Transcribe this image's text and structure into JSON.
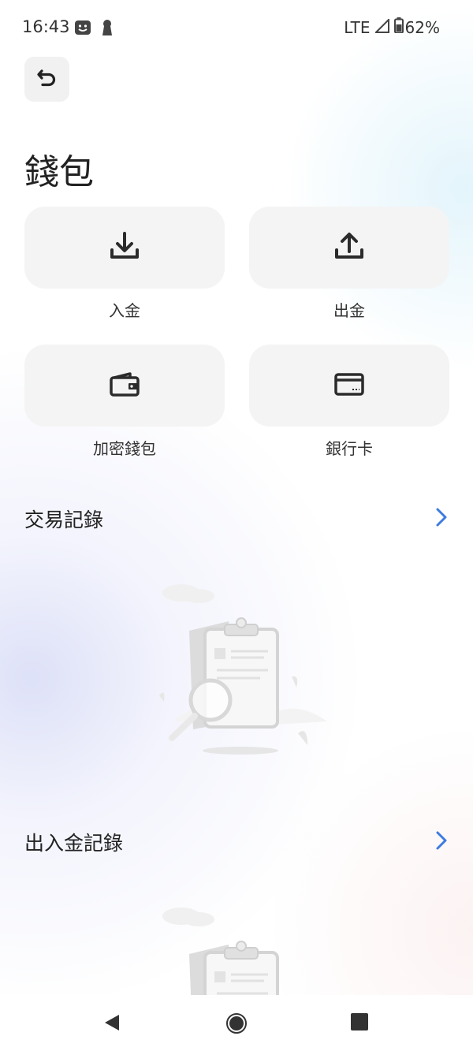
{
  "status_bar": {
    "time": "16:43",
    "network": "LTE",
    "battery": "62%",
    "icons": [
      "app-notification-icon",
      "keyhole-icon",
      "signal-icon",
      "battery-icon"
    ]
  },
  "header": {
    "back_icon": "undo-icon",
    "title": "錢包"
  },
  "actions": [
    {
      "label": "入金",
      "icon": "download-icon"
    },
    {
      "label": "出金",
      "icon": "upload-icon"
    },
    {
      "label": "加密錢包",
      "icon": "wallet-icon"
    },
    {
      "label": "銀行卡",
      "icon": "bank-card-icon"
    }
  ],
  "sections": {
    "transactions": {
      "title": "交易記錄",
      "chevron": "chevron-right-icon"
    },
    "deposits_withdrawals": {
      "title": "出入金記錄",
      "chevron": "chevron-right-icon"
    }
  },
  "colors": {
    "accent": "#3d7be0",
    "tile_bg": "#f4f4f4",
    "text": "#222222"
  },
  "nav": [
    "back-icon",
    "home-icon",
    "recents-icon"
  ]
}
